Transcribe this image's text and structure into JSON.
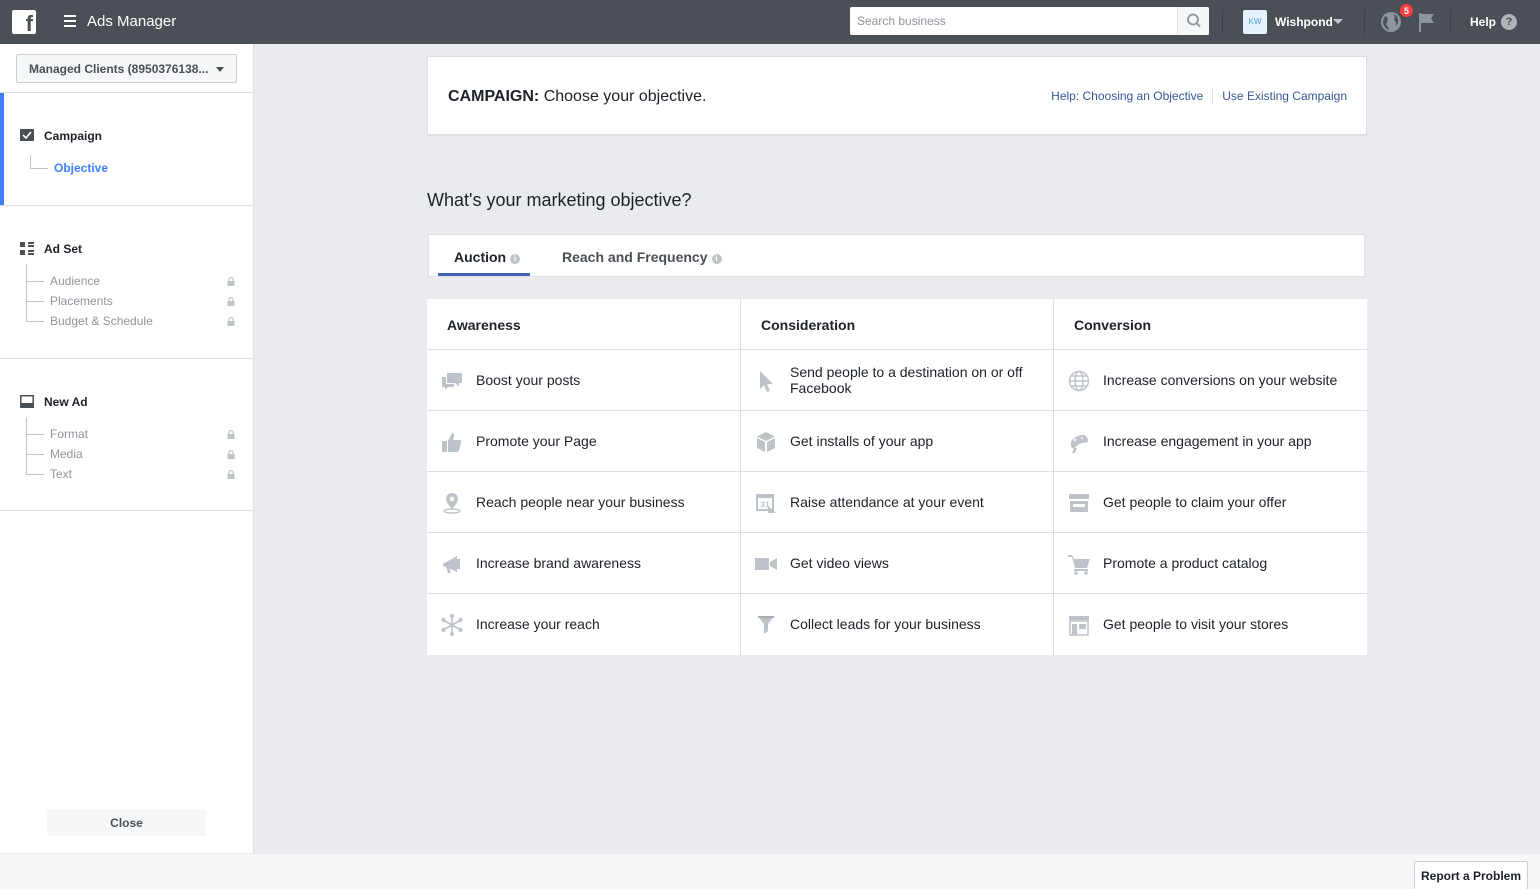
{
  "topbar": {
    "logo": "f",
    "app_title": "Ads Manager",
    "search_placeholder": "Search business",
    "account_initials": "KW",
    "account_name": "Wishpond",
    "notification_count": "5",
    "help_label": "Help",
    "help_glyph": "?"
  },
  "sidebar": {
    "clients_dropdown": "Managed Clients (8950376138...",
    "campaign": {
      "title": "Campaign",
      "items": [
        "Objective"
      ]
    },
    "adset": {
      "title": "Ad Set",
      "items": [
        "Audience",
        "Placements",
        "Budget & Schedule"
      ]
    },
    "newad": {
      "title": "New Ad",
      "items": [
        "Format",
        "Media",
        "Text"
      ]
    },
    "close_label": "Close"
  },
  "header": {
    "prefix": "CAMPAIGN:",
    "title": " Choose your objective.",
    "help_link": "Help: Choosing an Objective",
    "existing_link": "Use Existing Campaign"
  },
  "question": "What's your marketing objective?",
  "tabs": [
    {
      "label": "Auction",
      "active": true
    },
    {
      "label": "Reach and Frequency",
      "active": false
    }
  ],
  "info_glyph": "i",
  "columns": [
    {
      "title": "Awareness",
      "items": [
        {
          "label": "Boost your posts",
          "icon": "speech-bubbles-icon"
        },
        {
          "label": "Promote your Page",
          "icon": "thumbs-up-icon"
        },
        {
          "label": "Reach people near your business",
          "icon": "map-pin-icon"
        },
        {
          "label": "Increase brand awareness",
          "icon": "megaphone-icon"
        },
        {
          "label": "Increase your reach",
          "icon": "asterisk-reach-icon"
        }
      ]
    },
    {
      "title": "Consideration",
      "items": [
        {
          "label": "Send people to a destination on or off Facebook",
          "icon": "cursor-icon"
        },
        {
          "label": "Get installs of your app",
          "icon": "box-icon"
        },
        {
          "label": "Raise attendance at your event",
          "icon": "calendar-icon"
        },
        {
          "label": "Get video views",
          "icon": "video-camera-icon"
        },
        {
          "label": "Collect leads for your business",
          "icon": "funnel-icon"
        }
      ]
    },
    {
      "title": "Conversion",
      "items": [
        {
          "label": "Increase conversions on your website",
          "icon": "globe-icon"
        },
        {
          "label": "Increase engagement in your app",
          "icon": "gamepad-icon"
        },
        {
          "label": "Get people to claim your offer",
          "icon": "store-icon"
        },
        {
          "label": "Promote a product catalog",
          "icon": "shopping-cart-icon"
        },
        {
          "label": "Get people to visit your stores",
          "icon": "storefront-icon"
        }
      ]
    }
  ],
  "calendar_day": "31",
  "footer": {
    "report_label": "Report a Problem"
  },
  "colors": {
    "topbar": "#4b4f56",
    "accent": "#4080ff",
    "link": "#365899",
    "icon": "#bec3c9",
    "badge": "#fa3e3e"
  }
}
